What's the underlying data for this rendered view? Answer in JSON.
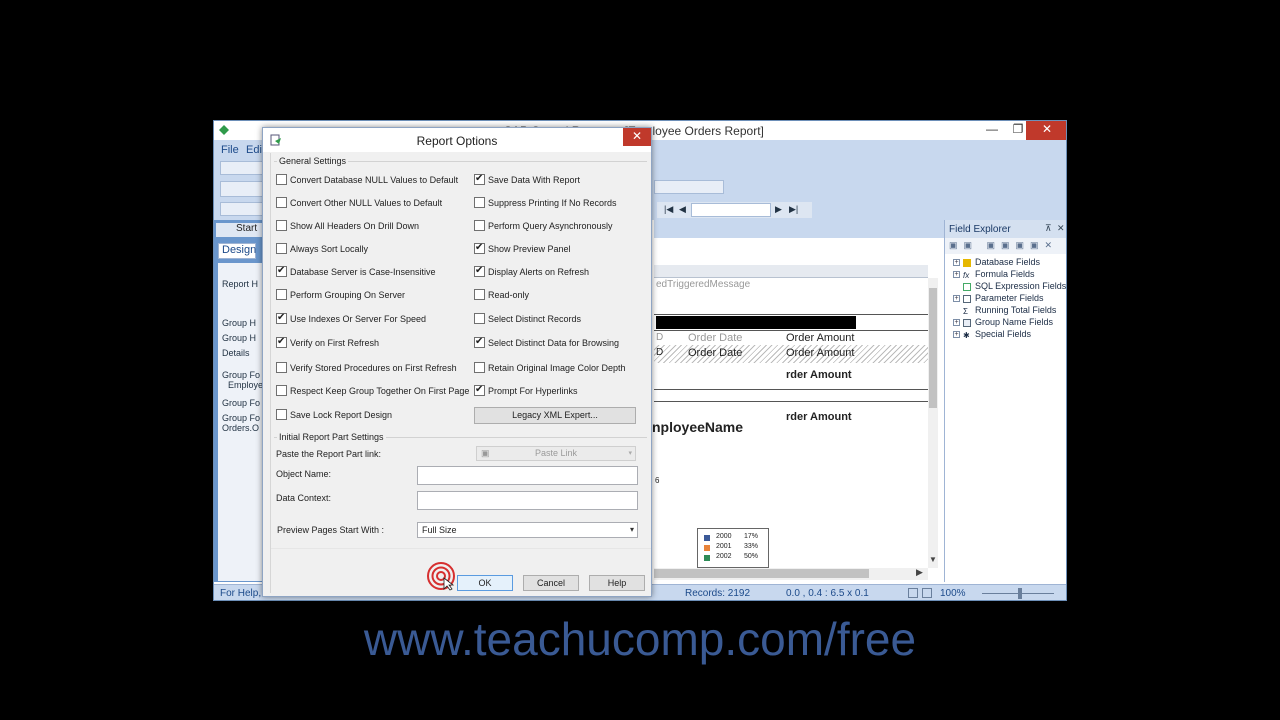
{
  "app": {
    "title": "SAP Crystal Reports - [Employee Orders Report]",
    "menu_file": "File",
    "menu_edit": "Edit",
    "start_tab": "Start",
    "design_tab": "Design",
    "status_help": "For Help,",
    "status_records": "Records: 2192",
    "status_coords": "0.0 , 0.4 : 6.5 x 0.1",
    "zoom": "100%"
  },
  "sections": [
    "Report H",
    "Group H",
    "Group H",
    "Details",
    "Group Fo",
    "Employe",
    "Group Fo",
    "Group Fo",
    "Orders.O"
  ],
  "report": {
    "triggered_message": "edTriggeredMessage",
    "order_date": "Order Date",
    "order_amount": "Order Amount",
    "order_amount_bold": "rder Amount",
    "employee_name": "nployeeName",
    "d_label": "D",
    "pct_fragment": "6"
  },
  "legend": [
    {
      "year": "2000",
      "pct": "17%",
      "color": "#3b5998"
    },
    {
      "year": "2001",
      "pct": "33%",
      "color": "#e8833a"
    },
    {
      "year": "2002",
      "pct": "50%",
      "color": "#2e8b57"
    }
  ],
  "field_explorer": {
    "title": "Field Explorer",
    "items": [
      {
        "label": "Database Fields",
        "icon": "database-icon",
        "expand": true
      },
      {
        "label": "Formula Fields",
        "icon": "formula-icon",
        "expand": true
      },
      {
        "label": "SQL Expression Fields",
        "icon": "sql-icon",
        "expand": false
      },
      {
        "label": "Parameter Fields",
        "icon": "parameter-icon",
        "expand": true
      },
      {
        "label": "Running Total Fields",
        "icon": "running-total-icon",
        "expand": false
      },
      {
        "label": "Group Name Fields",
        "icon": "group-name-icon",
        "expand": true
      },
      {
        "label": "Special Fields",
        "icon": "special-icon",
        "expand": true
      }
    ]
  },
  "dialog": {
    "title": "Report Options",
    "general_settings": "General Settings",
    "left_options": [
      {
        "label": "Convert Database NULL Values to Default",
        "checked": false
      },
      {
        "label": "Convert Other NULL Values to Default",
        "checked": false
      },
      {
        "label": "Show All Headers On Drill Down",
        "checked": false
      },
      {
        "label": "Always Sort Locally",
        "checked": false
      },
      {
        "label": "Database Server is Case-Insensitive",
        "checked": true
      },
      {
        "label": "Perform Grouping On Server",
        "checked": false
      },
      {
        "label": "Use Indexes Or Server For Speed",
        "checked": true
      },
      {
        "label": "Verify on First Refresh",
        "checked": true
      },
      {
        "label": "Verify Stored Procedures on First Refresh",
        "checked": false
      },
      {
        "label": "Respect Keep Group Together On First Page",
        "checked": false
      },
      {
        "label": "Save Lock Report Design",
        "checked": false
      }
    ],
    "right_options": [
      {
        "label": "Save Data With Report",
        "checked": true
      },
      {
        "label": "Suppress Printing If No Records",
        "checked": false
      },
      {
        "label": "Perform Query Asynchronously",
        "checked": false
      },
      {
        "label": "Show Preview Panel",
        "checked": true
      },
      {
        "label": "Display Alerts on Refresh",
        "checked": true
      },
      {
        "label": "Read-only",
        "checked": false
      },
      {
        "label": "Select Distinct Records",
        "checked": false
      },
      {
        "label": "Select Distinct Data for Browsing",
        "checked": true
      },
      {
        "label": "Retain Original Image Color Depth",
        "checked": false
      },
      {
        "label": "Prompt For Hyperlinks",
        "checked": true
      }
    ],
    "legacy_xml_button": "Legacy XML Expert...",
    "initial_report_part": "Initial Report Part Settings",
    "paste_link_label": "Paste the Report Part link:",
    "paste_link_button": "Paste Link",
    "object_name_label": "Object Name:",
    "object_name_value": "",
    "data_context_label": "Data Context:",
    "data_context_value": "",
    "preview_pages_label": "Preview Pages Start With :",
    "preview_pages_value": "Full Size",
    "ok": "OK",
    "cancel": "Cancel",
    "help": "Help"
  },
  "watermark": "www.teachucomp.com/free"
}
